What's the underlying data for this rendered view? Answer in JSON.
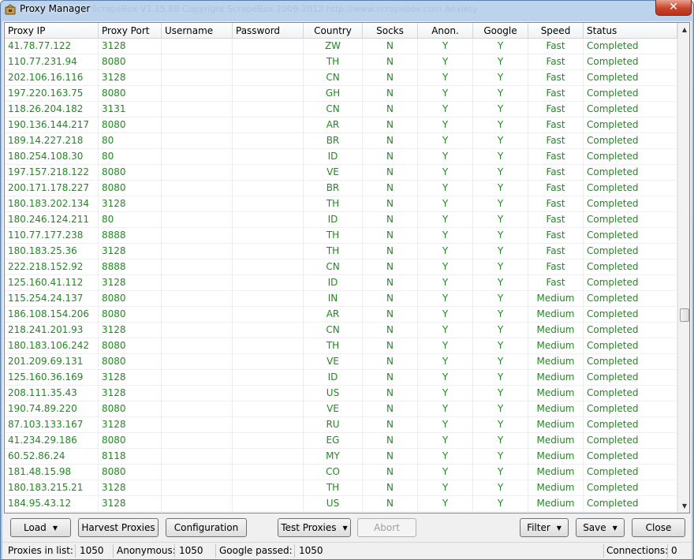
{
  "window": {
    "title": "Proxy Manager",
    "faint_title": "ScrapeBox V1.15.88 Copyright ScrapeBox 2009-2012 http://www.scrapebox.com Anxiety",
    "close_label": "✕"
  },
  "table": {
    "columns": [
      {
        "key": "ip",
        "label": "Proxy IP"
      },
      {
        "key": "port",
        "label": "Proxy Port"
      },
      {
        "key": "username",
        "label": "Username"
      },
      {
        "key": "password",
        "label": "Password"
      },
      {
        "key": "country",
        "label": "Country"
      },
      {
        "key": "socks",
        "label": "Socks"
      },
      {
        "key": "anon",
        "label": "Anon."
      },
      {
        "key": "google",
        "label": "Google"
      },
      {
        "key": "speed",
        "label": "Speed"
      },
      {
        "key": "status",
        "label": "Status"
      }
    ],
    "rows": [
      {
        "ip": "41.78.77.122",
        "port": "3128",
        "username": "",
        "password": "",
        "country": "ZW",
        "socks": "N",
        "anon": "Y",
        "google": "Y",
        "speed": "Fast",
        "status": "Completed"
      },
      {
        "ip": "110.77.231.94",
        "port": "8080",
        "username": "",
        "password": "",
        "country": "TH",
        "socks": "N",
        "anon": "Y",
        "google": "Y",
        "speed": "Fast",
        "status": "Completed"
      },
      {
        "ip": "202.106.16.116",
        "port": "3128",
        "username": "",
        "password": "",
        "country": "CN",
        "socks": "N",
        "anon": "Y",
        "google": "Y",
        "speed": "Fast",
        "status": "Completed"
      },
      {
        "ip": "197.220.163.75",
        "port": "8080",
        "username": "",
        "password": "",
        "country": "GH",
        "socks": "N",
        "anon": "Y",
        "google": "Y",
        "speed": "Fast",
        "status": "Completed"
      },
      {
        "ip": "118.26.204.182",
        "port": "3131",
        "username": "",
        "password": "",
        "country": "CN",
        "socks": "N",
        "anon": "Y",
        "google": "Y",
        "speed": "Fast",
        "status": "Completed"
      },
      {
        "ip": "190.136.144.217",
        "port": "8080",
        "username": "",
        "password": "",
        "country": "AR",
        "socks": "N",
        "anon": "Y",
        "google": "Y",
        "speed": "Fast",
        "status": "Completed"
      },
      {
        "ip": "189.14.227.218",
        "port": "80",
        "username": "",
        "password": "",
        "country": "BR",
        "socks": "N",
        "anon": "Y",
        "google": "Y",
        "speed": "Fast",
        "status": "Completed"
      },
      {
        "ip": "180.254.108.30",
        "port": "80",
        "username": "",
        "password": "",
        "country": "ID",
        "socks": "N",
        "anon": "Y",
        "google": "Y",
        "speed": "Fast",
        "status": "Completed"
      },
      {
        "ip": "197.157.218.122",
        "port": "8080",
        "username": "",
        "password": "",
        "country": "VE",
        "socks": "N",
        "anon": "Y",
        "google": "Y",
        "speed": "Fast",
        "status": "Completed"
      },
      {
        "ip": "200.171.178.227",
        "port": "8080",
        "username": "",
        "password": "",
        "country": "BR",
        "socks": "N",
        "anon": "Y",
        "google": "Y",
        "speed": "Fast",
        "status": "Completed"
      },
      {
        "ip": "180.183.202.134",
        "port": "3128",
        "username": "",
        "password": "",
        "country": "TH",
        "socks": "N",
        "anon": "Y",
        "google": "Y",
        "speed": "Fast",
        "status": "Completed"
      },
      {
        "ip": "180.246.124.211",
        "port": "80",
        "username": "",
        "password": "",
        "country": "ID",
        "socks": "N",
        "anon": "Y",
        "google": "Y",
        "speed": "Fast",
        "status": "Completed"
      },
      {
        "ip": "110.77.177.238",
        "port": "8888",
        "username": "",
        "password": "",
        "country": "TH",
        "socks": "N",
        "anon": "Y",
        "google": "Y",
        "speed": "Fast",
        "status": "Completed"
      },
      {
        "ip": "180.183.25.36",
        "port": "3128",
        "username": "",
        "password": "",
        "country": "TH",
        "socks": "N",
        "anon": "Y",
        "google": "Y",
        "speed": "Fast",
        "status": "Completed"
      },
      {
        "ip": "222.218.152.92",
        "port": "8888",
        "username": "",
        "password": "",
        "country": "CN",
        "socks": "N",
        "anon": "Y",
        "google": "Y",
        "speed": "Fast",
        "status": "Completed"
      },
      {
        "ip": "125.160.41.112",
        "port": "3128",
        "username": "",
        "password": "",
        "country": "ID",
        "socks": "N",
        "anon": "Y",
        "google": "Y",
        "speed": "Fast",
        "status": "Completed"
      },
      {
        "ip": "115.254.24.137",
        "port": "8080",
        "username": "",
        "password": "",
        "country": "IN",
        "socks": "N",
        "anon": "Y",
        "google": "Y",
        "speed": "Medium",
        "status": "Completed"
      },
      {
        "ip": "186.108.154.206",
        "port": "8080",
        "username": "",
        "password": "",
        "country": "AR",
        "socks": "N",
        "anon": "Y",
        "google": "Y",
        "speed": "Medium",
        "status": "Completed"
      },
      {
        "ip": "218.241.201.93",
        "port": "3128",
        "username": "",
        "password": "",
        "country": "CN",
        "socks": "N",
        "anon": "Y",
        "google": "Y",
        "speed": "Medium",
        "status": "Completed"
      },
      {
        "ip": "180.183.106.242",
        "port": "8080",
        "username": "",
        "password": "",
        "country": "TH",
        "socks": "N",
        "anon": "Y",
        "google": "Y",
        "speed": "Medium",
        "status": "Completed"
      },
      {
        "ip": "201.209.69.131",
        "port": "8080",
        "username": "",
        "password": "",
        "country": "VE",
        "socks": "N",
        "anon": "Y",
        "google": "Y",
        "speed": "Medium",
        "status": "Completed"
      },
      {
        "ip": "125.160.36.169",
        "port": "3128",
        "username": "",
        "password": "",
        "country": "ID",
        "socks": "N",
        "anon": "Y",
        "google": "Y",
        "speed": "Medium",
        "status": "Completed"
      },
      {
        "ip": "208.111.35.43",
        "port": "3128",
        "username": "",
        "password": "",
        "country": "US",
        "socks": "N",
        "anon": "Y",
        "google": "Y",
        "speed": "Medium",
        "status": "Completed"
      },
      {
        "ip": "190.74.89.220",
        "port": "8080",
        "username": "",
        "password": "",
        "country": "VE",
        "socks": "N",
        "anon": "Y",
        "google": "Y",
        "speed": "Medium",
        "status": "Completed"
      },
      {
        "ip": "87.103.133.167",
        "port": "3128",
        "username": "",
        "password": "",
        "country": "RU",
        "socks": "N",
        "anon": "Y",
        "google": "Y",
        "speed": "Medium",
        "status": "Completed"
      },
      {
        "ip": "41.234.29.186",
        "port": "8080",
        "username": "",
        "password": "",
        "country": "EG",
        "socks": "N",
        "anon": "Y",
        "google": "Y",
        "speed": "Medium",
        "status": "Completed"
      },
      {
        "ip": "60.52.86.24",
        "port": "8118",
        "username": "",
        "password": "",
        "country": "MY",
        "socks": "N",
        "anon": "Y",
        "google": "Y",
        "speed": "Medium",
        "status": "Completed"
      },
      {
        "ip": "181.48.15.98",
        "port": "8080",
        "username": "",
        "password": "",
        "country": "CO",
        "socks": "N",
        "anon": "Y",
        "google": "Y",
        "speed": "Medium",
        "status": "Completed"
      },
      {
        "ip": "180.183.215.21",
        "port": "3128",
        "username": "",
        "password": "",
        "country": "TH",
        "socks": "N",
        "anon": "Y",
        "google": "Y",
        "speed": "Medium",
        "status": "Completed"
      },
      {
        "ip": "184.95.43.12",
        "port": "3128",
        "username": "",
        "password": "",
        "country": "US",
        "socks": "N",
        "anon": "Y",
        "google": "Y",
        "speed": "Medium",
        "status": "Completed"
      }
    ]
  },
  "toolbar": {
    "load_label": "Load",
    "harvest_label": "Harvest Proxies",
    "configuration_label": "Configuration",
    "test_label": "Test Proxies",
    "abort_label": "Abort",
    "filter_label": "Filter",
    "save_label": "Save",
    "close_label": "Close",
    "caret": "▼"
  },
  "status": {
    "proxies_label": "Proxies in list:",
    "proxies_value": "1050",
    "anonymous_label": "Anonymous:",
    "anonymous_value": "1050",
    "google_label": "Google passed:",
    "google_value": "1050",
    "connections_label": "Connections:",
    "connections_value": "0"
  },
  "colors": {
    "row_text": "#1e8b1e",
    "titlebar": "#bcd3ec",
    "close_button": "#c7432a"
  },
  "icons": {
    "app": "proxy-manager-app-icon",
    "scroll_up": "▲",
    "scroll_down": "▼"
  }
}
